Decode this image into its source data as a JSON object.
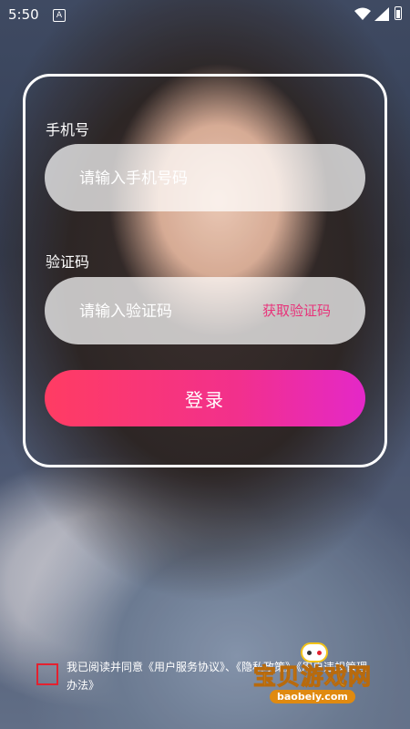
{
  "status_bar": {
    "time": "5:50",
    "notification_icon": "A"
  },
  "login_form": {
    "phone_label": "手机号",
    "phone_placeholder": "请输入手机号码",
    "code_label": "验证码",
    "code_placeholder": "请输入验证码",
    "get_code_label": "获取验证码",
    "login_button_label": "登录"
  },
  "agreement": {
    "prefix": "我已阅读并同意",
    "user_service_agreement": "《用户服务协议》",
    "separator": "、",
    "privacy_policy": "《隐私政策》",
    "user_rules": "《用户违规管理办法》",
    "checked": false
  },
  "watermark": {
    "title": "宝贝游戏网",
    "url": "baobeiy.com"
  },
  "colors": {
    "accent_pink": "#e8337a",
    "button_gradient_start": "#ff3c63",
    "button_gradient_end": "#e428c8",
    "checkbox_border": "#e4212f"
  }
}
